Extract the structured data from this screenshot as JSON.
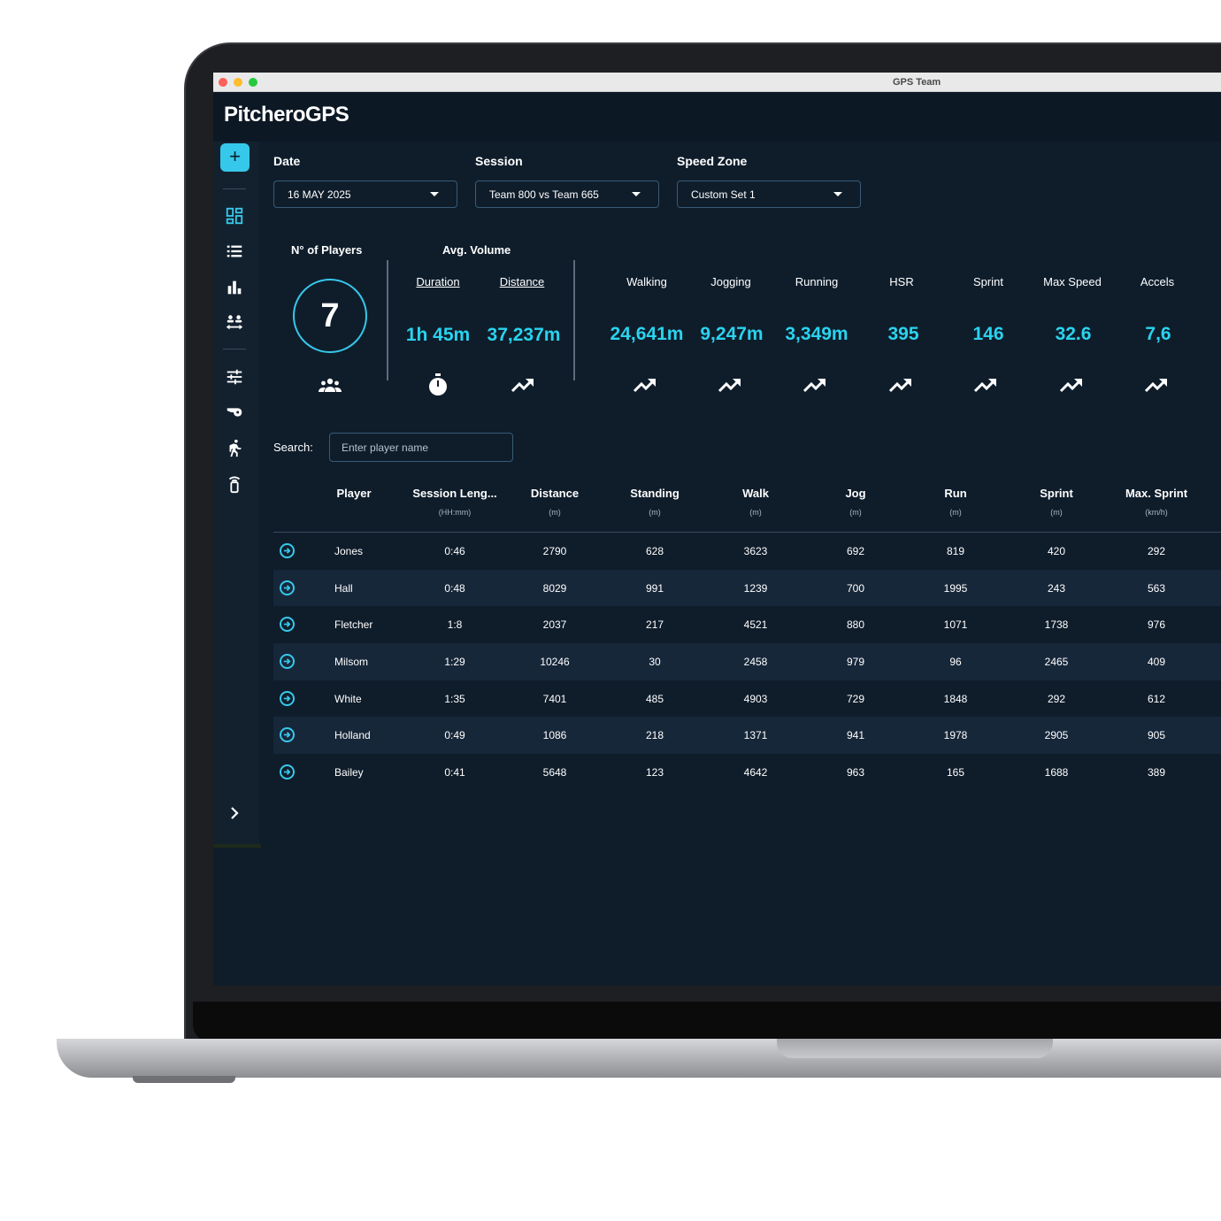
{
  "window": {
    "title": "GPS Team"
  },
  "app": {
    "logo": "PitcheroGPS"
  },
  "sidebar": {
    "add_label": "+",
    "items": [
      {
        "icon": "dashboard-icon"
      },
      {
        "icon": "list-icon"
      },
      {
        "icon": "bar-chart-icon"
      },
      {
        "icon": "team-compare-icon"
      },
      {
        "icon": "sliders-icon"
      },
      {
        "icon": "whistle-icon"
      },
      {
        "icon": "runner-icon"
      },
      {
        "icon": "gps-device-icon"
      }
    ],
    "expand_icon": "chevron-right-icon"
  },
  "filters": {
    "date": {
      "label": "Date",
      "value": "16 MAY 2025"
    },
    "session": {
      "label": "Session",
      "value": "Team 800 vs Team 665"
    },
    "speed_zone": {
      "label": "Speed Zone",
      "value": "Custom Set 1"
    }
  },
  "stats": {
    "players_label": "N° of Players",
    "players_count": "7",
    "avg_volume_label": "Avg. Volume",
    "duration": {
      "label": "Duration",
      "value": "1h 45m"
    },
    "distance": {
      "label": "Distance",
      "value": "37,237m"
    },
    "metrics": [
      {
        "label": "Walking",
        "value": "24,641m"
      },
      {
        "label": "Jogging",
        "value": "9,247m"
      },
      {
        "label": "Running",
        "value": "3,349m"
      },
      {
        "label": "HSR",
        "value": "395"
      },
      {
        "label": "Sprint",
        "value": "146"
      },
      {
        "label": "Max Speed",
        "value": "32.6"
      },
      {
        "label": "Accels",
        "value": "7,6"
      }
    ]
  },
  "search": {
    "label": "Search:",
    "placeholder": "Enter player name"
  },
  "table": {
    "columns": [
      {
        "name": "Player",
        "unit": ""
      },
      {
        "name": "Session Leng...",
        "unit": "(HH:mm)"
      },
      {
        "name": "Distance",
        "unit": "(m)"
      },
      {
        "name": "Standing",
        "unit": "(m)"
      },
      {
        "name": "Walk",
        "unit": "(m)"
      },
      {
        "name": "Jog",
        "unit": "(m)"
      },
      {
        "name": "Run",
        "unit": "(m)"
      },
      {
        "name": "Sprint",
        "unit": "(m)"
      },
      {
        "name": "Max. Sprint",
        "unit": "(km/h)"
      }
    ],
    "rows": [
      [
        "Jones",
        "0:46",
        "2790",
        "628",
        "3623",
        "692",
        "819",
        "420",
        "292"
      ],
      [
        "Hall",
        "0:48",
        "8029",
        "991",
        "1239",
        "700",
        "1995",
        "243",
        "563"
      ],
      [
        "Fletcher",
        "1:8",
        "2037",
        "217",
        "4521",
        "880",
        "1071",
        "1738",
        "976"
      ],
      [
        "Milsom",
        "1:29",
        "10246",
        "30",
        "2458",
        "979",
        "96",
        "2465",
        "409"
      ],
      [
        "White",
        "1:35",
        "7401",
        "485",
        "4903",
        "729",
        "1848",
        "292",
        "612"
      ],
      [
        "Holland",
        "0:49",
        "1086",
        "218",
        "1371",
        "941",
        "1978",
        "2905",
        "905"
      ],
      [
        "Bailey",
        "0:41",
        "5648",
        "123",
        "4642",
        "963",
        "165",
        "1688",
        "389"
      ]
    ]
  },
  "colors": {
    "accent": "#36c8ea",
    "value": "#2ad3ee",
    "background": "#0f1d2b"
  }
}
